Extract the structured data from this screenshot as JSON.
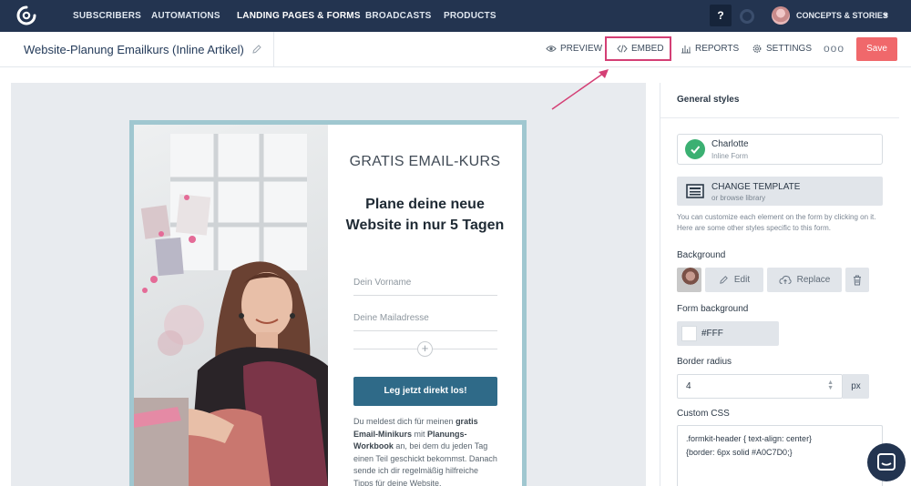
{
  "nav": {
    "items": [
      "SUBSCRIBERS",
      "AUTOMATIONS",
      "LANDING PAGES & FORMS",
      "BROADCASTS",
      "PRODUCTS"
    ],
    "help_label": "?",
    "account_name": "CONCEPTS & STORIES"
  },
  "toolbar": {
    "form_title": "Website-Planung Emailkurs (Inline Artikel)",
    "preview_label": "PREVIEW",
    "embed_label": "EMBED",
    "reports_label": "REPORTS",
    "settings_label": "SETTINGS",
    "more_label": "ooo",
    "save_label": "Save",
    "highlight_color": "#D43F75"
  },
  "form": {
    "kicker": "GRATIS EMAIL-KURS",
    "headline": "Plane deine neue Website in nur 5 Tagen",
    "first_name_placeholder": "Dein Vorname",
    "email_placeholder": "Deine Mailadresse",
    "button_label": "Leg jetzt direkt los!",
    "desc_1": "Du meldest dich für meinen ",
    "desc_2": "gratis Email-Minikurs",
    "desc_3": " mit ",
    "desc_4": "Planungs-Workbook",
    "desc_5": " an, bei dem du jeden Tag einen Teil geschickt bekommst. Danach sende ich dir regelmäßig hilfreiche Tipps für deine Website.",
    "border_color": "#A0C7D0",
    "button_color": "#2F6A88"
  },
  "panel": {
    "title": "General styles",
    "template_name": "Charlotte",
    "template_sub": "Inline Form",
    "change_template_title": "CHANGE TEMPLATE",
    "change_template_sub": "or browse library",
    "hint": "You can customize each element on the form by clicking on it. Here are some other styles specific to this form.",
    "background_label": "Background",
    "edit_label": "Edit",
    "replace_label": "Replace",
    "form_background_label": "Form background",
    "form_background_value": "#FFF",
    "border_radius_label": "Border radius",
    "border_radius_value": "4",
    "border_radius_unit": "px",
    "custom_css_label": "Custom CSS",
    "custom_css_line_1": ".formkit-header { text-align: center}",
    "custom_css_line_2": "{border: 6px solid  #A0C7D0;}"
  }
}
